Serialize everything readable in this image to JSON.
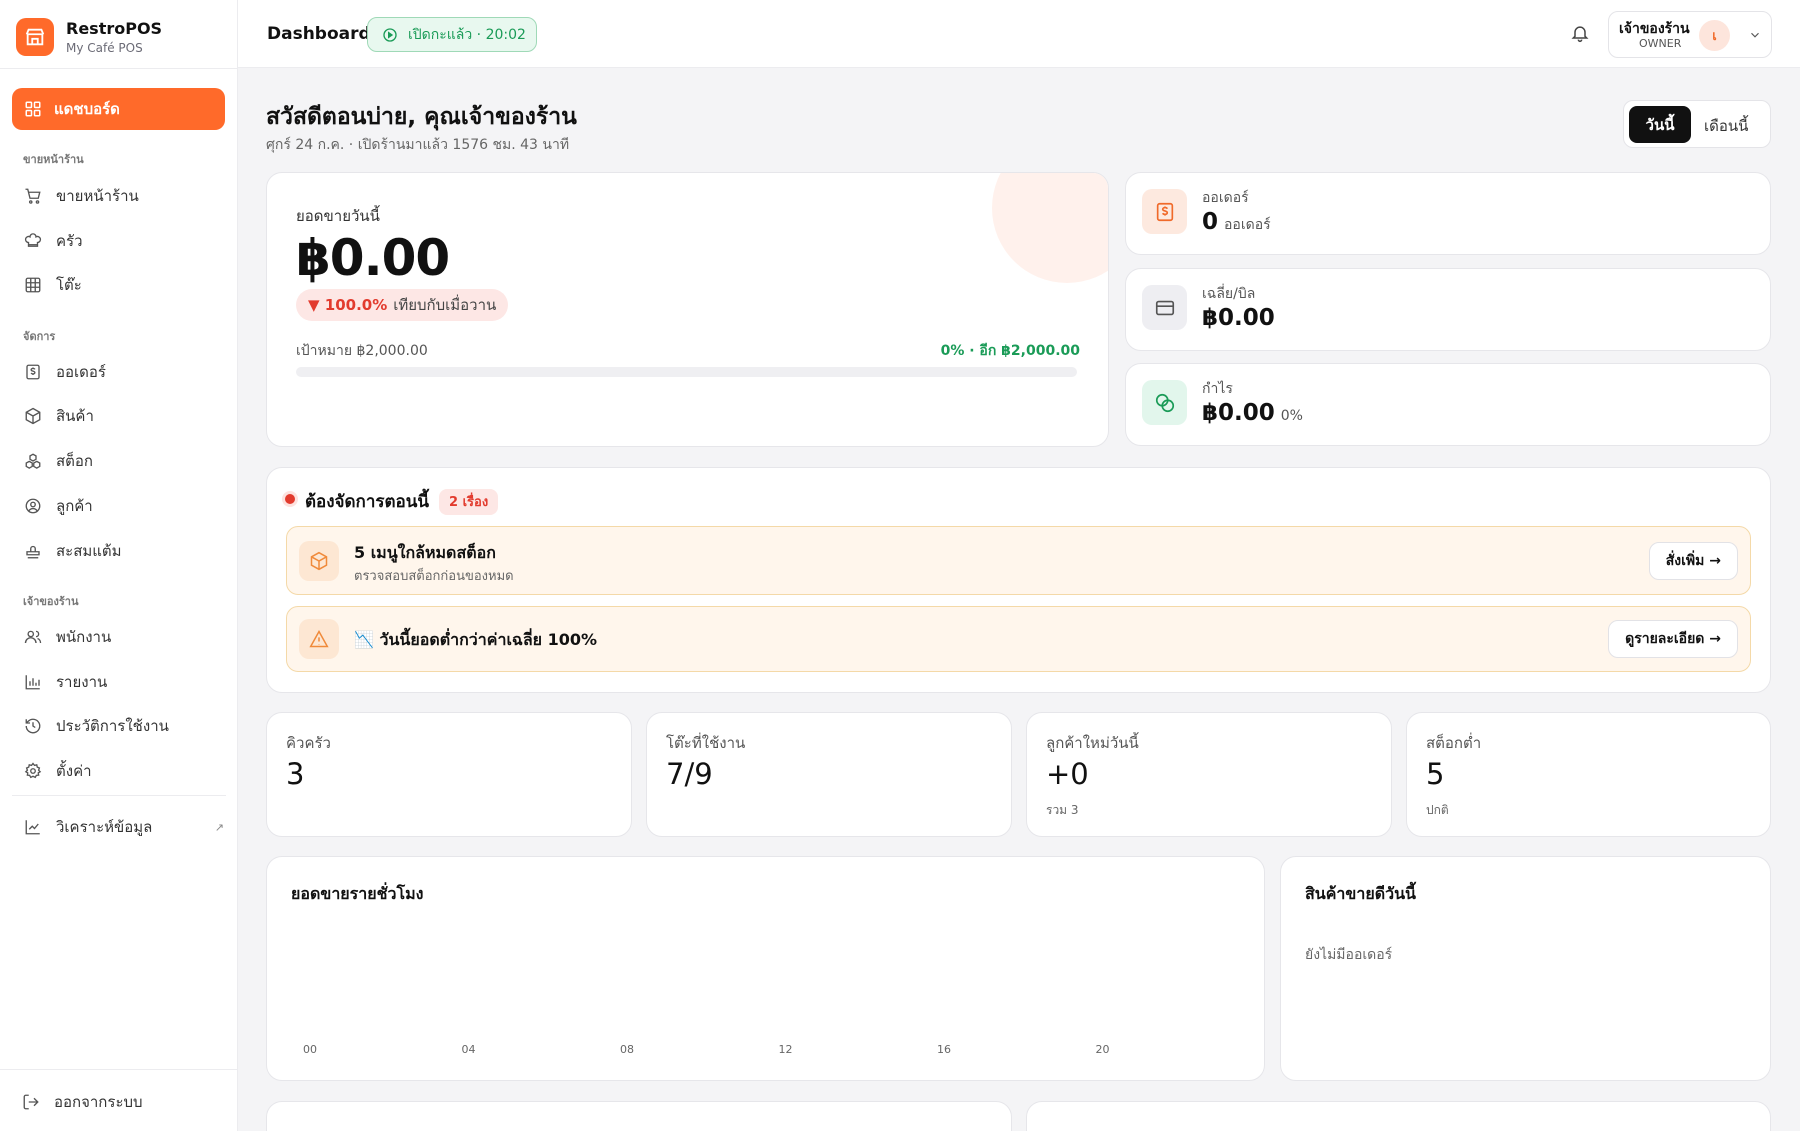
{
  "brand": {
    "name": "RestroPOS",
    "sub": "My Café POS"
  },
  "sidebar": {
    "active": "แดชบอร์ด",
    "sections": {
      "front": "ขายหน้าร้าน",
      "manage": "จัดการ",
      "owner": "เจ้าของร้าน"
    },
    "items": [
      {
        "label": "ขายหน้าร้าน",
        "icon": "cart-icon"
      },
      {
        "label": "ครัว",
        "icon": "chef-hat-icon"
      },
      {
        "label": "โต๊ะ",
        "icon": "table-grid-icon"
      },
      {
        "label": "ออเดอร์",
        "icon": "receipt-icon"
      },
      {
        "label": "สินค้า",
        "icon": "box-icon"
      },
      {
        "label": "สต็อก",
        "icon": "boxes-icon"
      },
      {
        "label": "ลูกค้า",
        "icon": "user-circle-icon"
      },
      {
        "label": "สะสมแต้ม",
        "icon": "stamp-icon"
      },
      {
        "label": "พนักงาน",
        "icon": "users-icon"
      },
      {
        "label": "รายงาน",
        "icon": "bar-chart-icon"
      },
      {
        "label": "ประวัติการใช้งาน",
        "icon": "history-icon"
      },
      {
        "label": "ตั้งค่า",
        "icon": "gear-icon"
      },
      {
        "label": "วิเคราะห์ข้อมูล",
        "icon": "line-chart-icon"
      }
    ],
    "external_mark": "↗",
    "logout": "ออกจากระบบ"
  },
  "topbar": {
    "title": "Dashboard",
    "status": "เปิดกะแล้ว · 20:02",
    "user_name": "เจ้าของร้าน",
    "user_role": "OWNER",
    "avatar": "เ"
  },
  "greeting": {
    "title": "สวัสดีตอนบ่าย, คุณเจ้าของร้าน",
    "sub": "ศุกร์ 24 ก.ค. · เปิดร้านมาแล้ว 1576 ชม. 43 นาที"
  },
  "period": {
    "today": "วันนี้",
    "month": "เดือนนี้"
  },
  "sales": {
    "label": "ยอดขายวันนี้",
    "amount": "฿0.00",
    "change": "▼ 100.0%",
    "compare": "เทียบกับเมื่อวาน",
    "goal": "เป้าหมาย ฿2,000.00",
    "progress_text": "0% · อีก ฿2,000.00",
    "progress": 0
  },
  "mini": [
    {
      "label": "ออเดอร์",
      "value": "0",
      "suffix": "ออเดอร์",
      "icon": "receipt-icon"
    },
    {
      "label": "เฉลี่ย/บิล",
      "value": "฿0.00",
      "suffix": "",
      "icon": "card-icon"
    },
    {
      "label": "กำไร",
      "value": "฿0.00",
      "suffix": "0%",
      "icon": "coins-icon"
    }
  ],
  "todo": {
    "title": "ต้องจัดการตอนนี้",
    "count": "2 เรื่อง",
    "alerts": [
      {
        "title": "5 เมนูใกล้หมดสต็อก",
        "sub": "ตรวจสอบสต็อกก่อนของหมด",
        "action": "สั่งเพิ่ม →",
        "icon": "box-icon"
      },
      {
        "title": "📉 วันนี้ยอดต่ำกว่าค่าเฉลี่ย 100%",
        "sub": "",
        "action": "ดูรายละเอียด →",
        "icon": "warning-icon"
      }
    ]
  },
  "stats": [
    {
      "label": "คิวครัว",
      "value": "3",
      "sub": ""
    },
    {
      "label": "โต๊ะที่ใช้งาน",
      "value": "7/9",
      "sub": ""
    },
    {
      "label": "ลูกค้าใหม่วันนี้",
      "value": "+0",
      "sub": "รวม 3"
    },
    {
      "label": "สต็อกต่ำ",
      "value": "5",
      "sub": "ปกติ"
    }
  ],
  "hourly": {
    "title": "ยอดขายรายชั่วโมง"
  },
  "chart_data": {
    "type": "bar",
    "title": "ยอดขายรายชั่วโมง",
    "categories": [
      "00",
      "04",
      "08",
      "12",
      "16",
      "20"
    ],
    "values": [
      0,
      0,
      0,
      0,
      0,
      0
    ]
  },
  "top_products": {
    "title": "สินค้าขายดีวันนี้",
    "empty": "ยังไม่มีออเดอร์"
  },
  "colors": {
    "accent": "#ff6a2a",
    "success": "#1a9b57",
    "danger": "#e23b2e"
  }
}
